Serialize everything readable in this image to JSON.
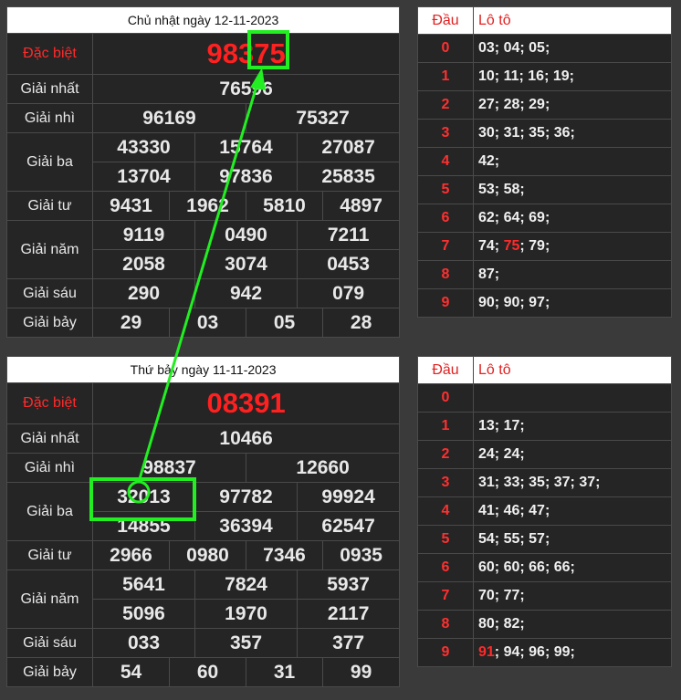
{
  "results": [
    {
      "title": "Chủ nhật ngày 12-11-2023",
      "special_label": "Đặc biệt",
      "special": "98375",
      "rows": [
        {
          "label": "Giải nhất",
          "lines": [
            [
              "76596"
            ]
          ]
        },
        {
          "label": "Giải nhì",
          "lines": [
            [
              "96169",
              "75327"
            ]
          ]
        },
        {
          "label": "Giải ba",
          "lines": [
            [
              "43330",
              "15764",
              "27087"
            ],
            [
              "13704",
              "97836",
              "25835"
            ]
          ]
        },
        {
          "label": "Giải tư",
          "lines": [
            [
              "9431",
              "1962",
              "5810",
              "4897"
            ]
          ]
        },
        {
          "label": "Giải năm",
          "lines": [
            [
              "9119",
              "0490",
              "7211"
            ],
            [
              "2058",
              "3074",
              "0453"
            ]
          ]
        },
        {
          "label": "Giải sáu",
          "lines": [
            [
              "290",
              "942",
              "079"
            ]
          ]
        },
        {
          "label": "Giải bảy",
          "lines": [
            [
              "29",
              "03",
              "05",
              "28"
            ]
          ]
        }
      ]
    },
    {
      "title": "Thứ bảy ngày 11-11-2023",
      "special_label": "Đặc biệt",
      "special": "08391",
      "rows": [
        {
          "label": "Giải nhất",
          "lines": [
            [
              "10466"
            ]
          ]
        },
        {
          "label": "Giải nhì",
          "lines": [
            [
              "98837",
              "12660"
            ]
          ]
        },
        {
          "label": "Giải ba",
          "lines": [
            [
              "32013",
              "97782",
              "99924"
            ],
            [
              "14855",
              "36394",
              "62547"
            ]
          ]
        },
        {
          "label": "Giải tư",
          "lines": [
            [
              "2966",
              "0980",
              "7346",
              "0935"
            ]
          ]
        },
        {
          "label": "Giải năm",
          "lines": [
            [
              "5641",
              "7824",
              "5937"
            ],
            [
              "5096",
              "1970",
              "2117"
            ]
          ]
        },
        {
          "label": "Giải sáu",
          "lines": [
            [
              "033",
              "357",
              "377"
            ]
          ]
        },
        {
          "label": "Giải bảy",
          "lines": [
            [
              "54",
              "60",
              "31",
              "99"
            ]
          ]
        }
      ]
    }
  ],
  "loto": [
    {
      "head_label": "Đầu",
      "loto_label": "Lô tô",
      "rows": [
        {
          "dau": "0",
          "items": [
            "03",
            "04",
            "05"
          ]
        },
        {
          "dau": "1",
          "items": [
            "10",
            "11",
            "16",
            "19"
          ]
        },
        {
          "dau": "2",
          "items": [
            "27",
            "28",
            "29"
          ]
        },
        {
          "dau": "3",
          "items": [
            "30",
            "31",
            "35",
            "36"
          ]
        },
        {
          "dau": "4",
          "items": [
            "42"
          ]
        },
        {
          "dau": "5",
          "items": [
            "53",
            "58"
          ]
        },
        {
          "dau": "6",
          "items": [
            "62",
            "64",
            "69"
          ]
        },
        {
          "dau": "7",
          "items": [
            "74",
            "75",
            "79"
          ],
          "highlight": "75"
        },
        {
          "dau": "8",
          "items": [
            "87"
          ]
        },
        {
          "dau": "9",
          "items": [
            "90",
            "90",
            "97"
          ]
        }
      ]
    },
    {
      "head_label": "Đầu",
      "loto_label": "Lô tô",
      "rows": [
        {
          "dau": "0",
          "items": []
        },
        {
          "dau": "1",
          "items": [
            "13",
            "17"
          ]
        },
        {
          "dau": "2",
          "items": [
            "24",
            "24"
          ]
        },
        {
          "dau": "3",
          "items": [
            "31",
            "33",
            "35",
            "37",
            "37"
          ]
        },
        {
          "dau": "4",
          "items": [
            "41",
            "46",
            "47"
          ]
        },
        {
          "dau": "5",
          "items": [
            "54",
            "55",
            "57"
          ]
        },
        {
          "dau": "6",
          "items": [
            "60",
            "60",
            "66",
            "66"
          ]
        },
        {
          "dau": "7",
          "items": [
            "70",
            "77"
          ]
        },
        {
          "dau": "8",
          "items": [
            "80",
            "82"
          ]
        },
        {
          "dau": "9",
          "items": [
            "91",
            "94",
            "96",
            "99"
          ],
          "highlight": "91"
        }
      ]
    }
  ],
  "annotation_color": "#22ee22"
}
